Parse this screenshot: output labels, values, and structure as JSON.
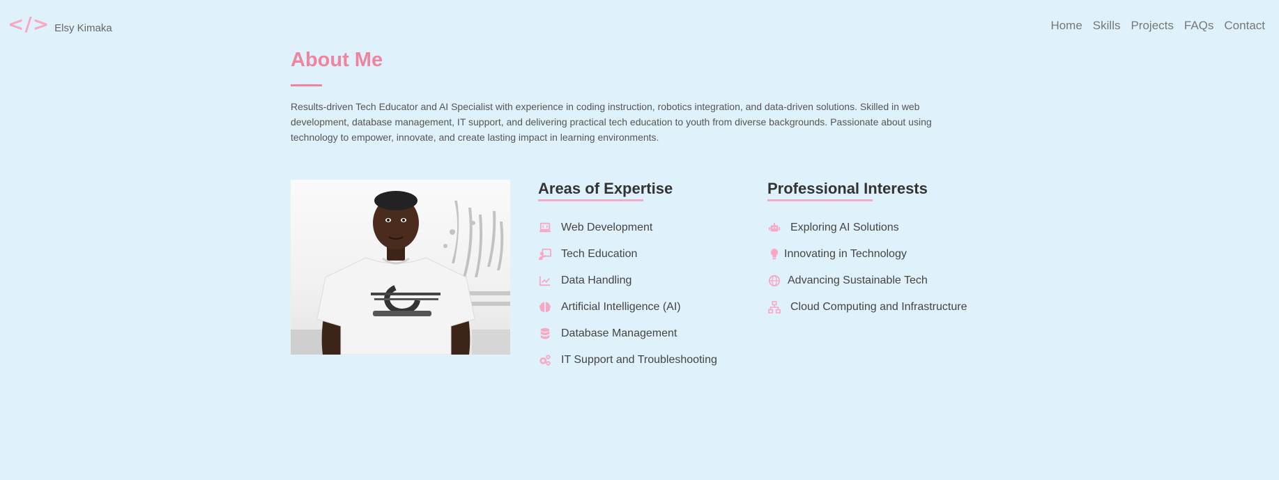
{
  "header": {
    "logo_symbol": "</>",
    "name": "Elsy Kimaka",
    "nav": [
      "Home",
      "Skills",
      "Projects",
      "FAQs",
      "Contact"
    ]
  },
  "about": {
    "title": "About Me",
    "description": "Results-driven Tech Educator and AI Specialist with experience in coding instruction, robotics integration, and data-driven solutions. Skilled in web development, database management, IT support, and delivering practical tech education to youth from diverse backgrounds. Passionate about using technology to empower, innovate, and create lasting impact in learning environments."
  },
  "expertise": {
    "title": "Areas of Expertise",
    "items": [
      {
        "icon": "laptop-code-icon",
        "label": "Web Development"
      },
      {
        "icon": "chalkboard-teacher-icon",
        "label": "Tech Education"
      },
      {
        "icon": "chart-line-icon",
        "label": "Data Handling"
      },
      {
        "icon": "brain-icon",
        "label": "Artificial Intelligence (AI)"
      },
      {
        "icon": "database-icon",
        "label": "Database Management"
      },
      {
        "icon": "gears-icon",
        "label": "IT Support and Troubleshooting"
      }
    ]
  },
  "interests": {
    "title": "Professional Interests",
    "items": [
      {
        "icon": "robot-icon",
        "label": "Exploring AI Solutions"
      },
      {
        "icon": "lightbulb-icon",
        "label": "Innovating in Technology"
      },
      {
        "icon": "globe-icon",
        "label": "Advancing Sustainable Tech"
      },
      {
        "icon": "network-icon",
        "label": "Cloud Computing and Infrastructure"
      }
    ]
  },
  "colors": {
    "background": "#dff1fb",
    "accent": "#f0849f",
    "icon": "#f7a9c4",
    "text": "#444444"
  }
}
